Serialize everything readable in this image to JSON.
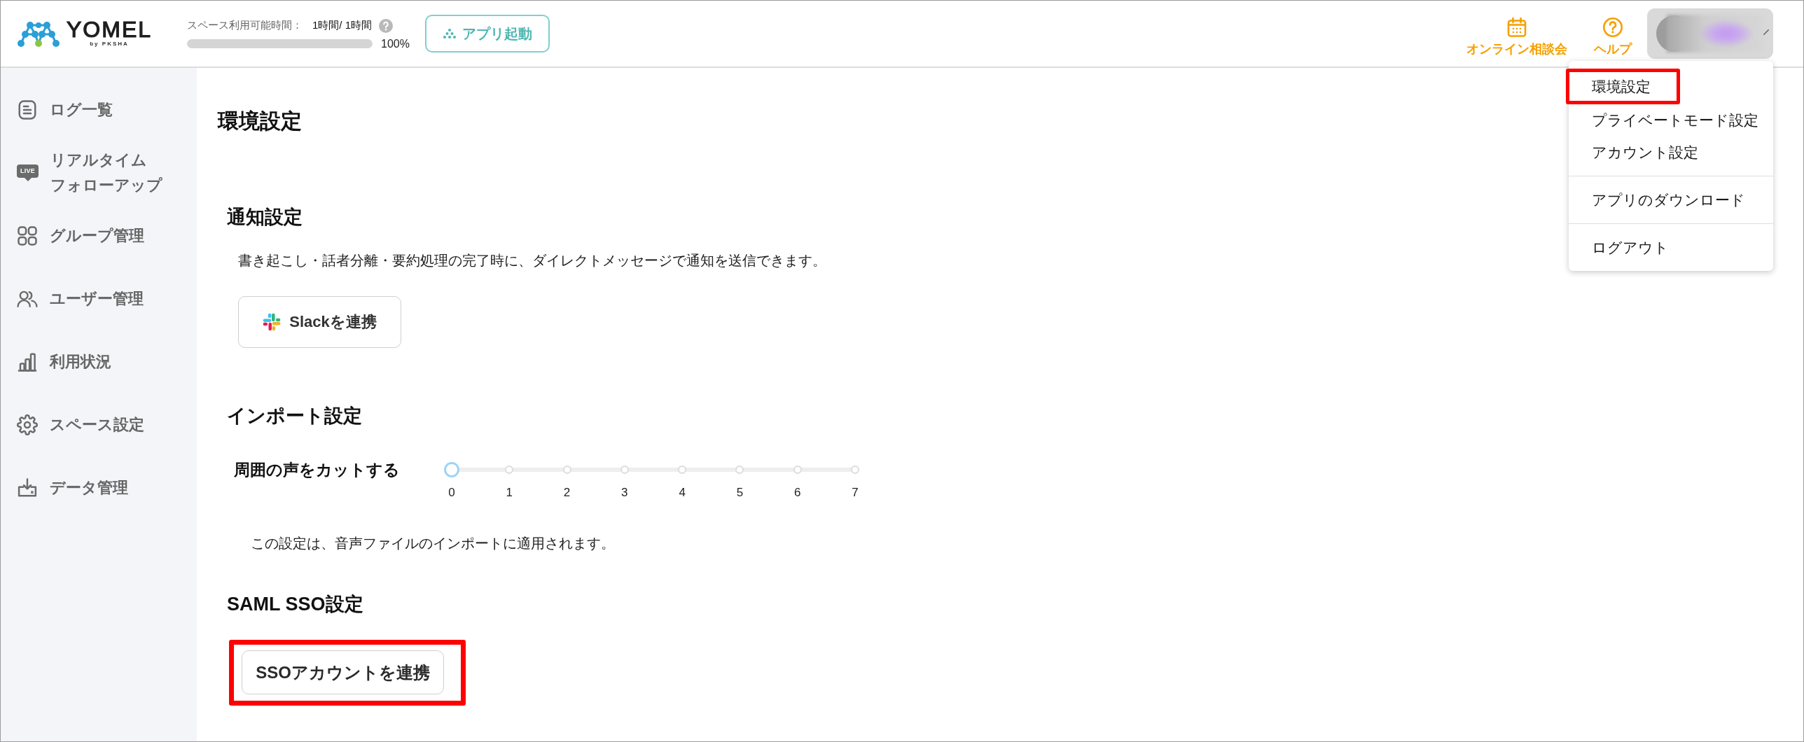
{
  "header": {
    "logo": {
      "name": "YOMEL",
      "byline": "by PKSHA"
    },
    "usage": {
      "label": "スペース利用可能時間：",
      "value": "1時間/ 1時間",
      "level": 1,
      "percent": "100%"
    },
    "launch_button": "アプリ起動",
    "links": [
      {
        "label": "オンライン相談会"
      },
      {
        "label": "ヘルプ"
      }
    ],
    "user_menu": {
      "expanded": true,
      "groups": [
        {
          "items": [
            {
              "label": "環境設定",
              "highlighted": true
            },
            {
              "label": "プライベートモード設定",
              "highlighted": false
            },
            {
              "label": "アカウント設定",
              "highlighted": false
            }
          ]
        },
        {
          "items": [
            {
              "label": "アプリのダウンロード",
              "highlighted": false
            }
          ]
        },
        {
          "items": [
            {
              "label": "ログアウト",
              "highlighted": false
            }
          ]
        }
      ]
    }
  },
  "sidebar": {
    "items": [
      {
        "label_lines": [
          "ログ一覧"
        ],
        "selected": false
      },
      {
        "label_lines": [
          "リアルタイム",
          "フォローアップ"
        ],
        "badge": "LIVE",
        "selected": false
      },
      {
        "label_lines": [
          "グループ管理"
        ],
        "selected": false
      },
      {
        "label_lines": [
          "ユーザー管理"
        ],
        "selected": false
      },
      {
        "label_lines": [
          "利用状況"
        ],
        "selected": false
      },
      {
        "label_lines": [
          "スペース設定"
        ],
        "selected": false
      },
      {
        "label_lines": [
          "データ管理"
        ],
        "selected": false
      }
    ]
  },
  "main": {
    "title": "環境設定",
    "notification": {
      "title": "通知設定",
      "description": "書き起こし・話者分離・要約処理の完了時に、ダイレクトメッセージで通知を送信できます。",
      "button": {
        "label": "Slackを連携",
        "highlighted": false
      }
    },
    "import": {
      "title": "インポート設定",
      "slider": {
        "label": "周囲の声をカットする",
        "level": 0,
        "ticks": [
          "0",
          "1",
          "2",
          "3",
          "4",
          "5",
          "6",
          "7"
        ]
      },
      "note": "この設定は、音声ファイルのインポートに適用されます。"
    },
    "sso": {
      "title": "SAML SSO設定",
      "button": {
        "label": "SSOアカウントを連携",
        "highlighted": true
      }
    }
  }
}
